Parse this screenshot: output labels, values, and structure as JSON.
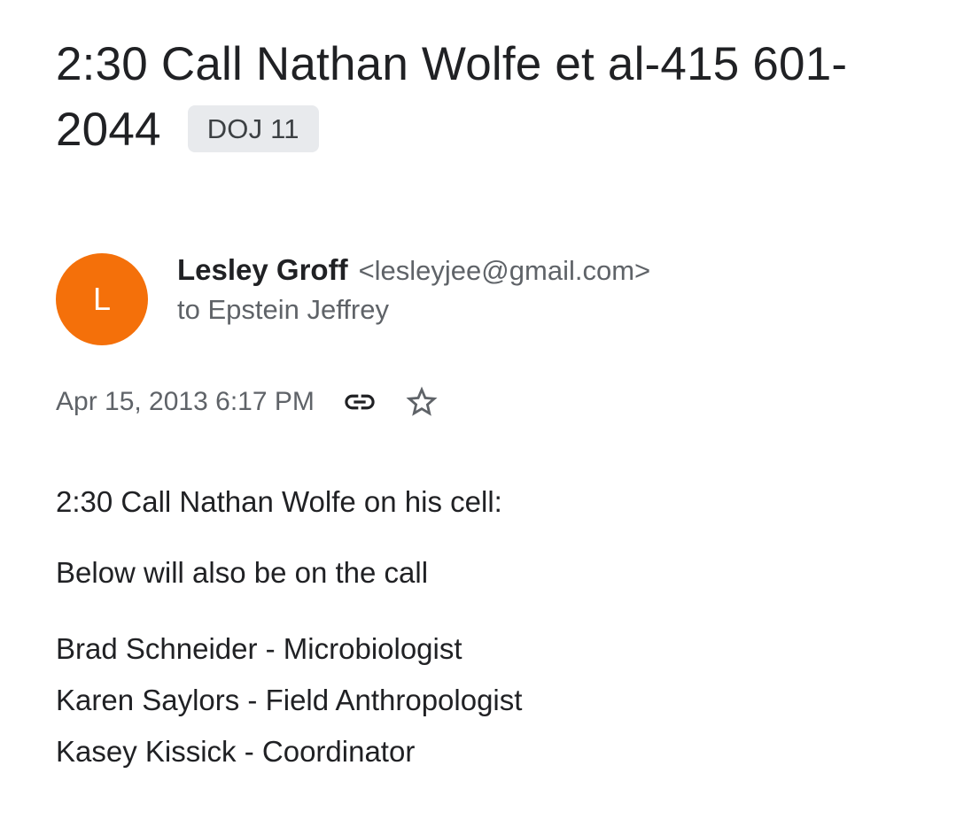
{
  "email": {
    "subject": "2:30 Call Nathan Wolfe et al-415 601-2044",
    "label": "DOJ 11",
    "sender": {
      "avatar_initial": "L",
      "avatar_color": "#f4700a",
      "name": "Lesley Groff",
      "email": "<lesleyjee@gmail.com>",
      "recipient_line": "to Epstein Jeffrey"
    },
    "date": "Apr 15, 2013 6:17 PM",
    "icons": {
      "link": "link-icon",
      "star": "star-icon"
    },
    "body": {
      "line1": "2:30 Call Nathan Wolfe on his cell:",
      "line2": "Below will also be on the call",
      "attendees": [
        "Brad Schneider - Microbiologist",
        "Karen Saylors - Field Anthropologist",
        "Kasey Kissick - Coordinator"
      ]
    }
  }
}
